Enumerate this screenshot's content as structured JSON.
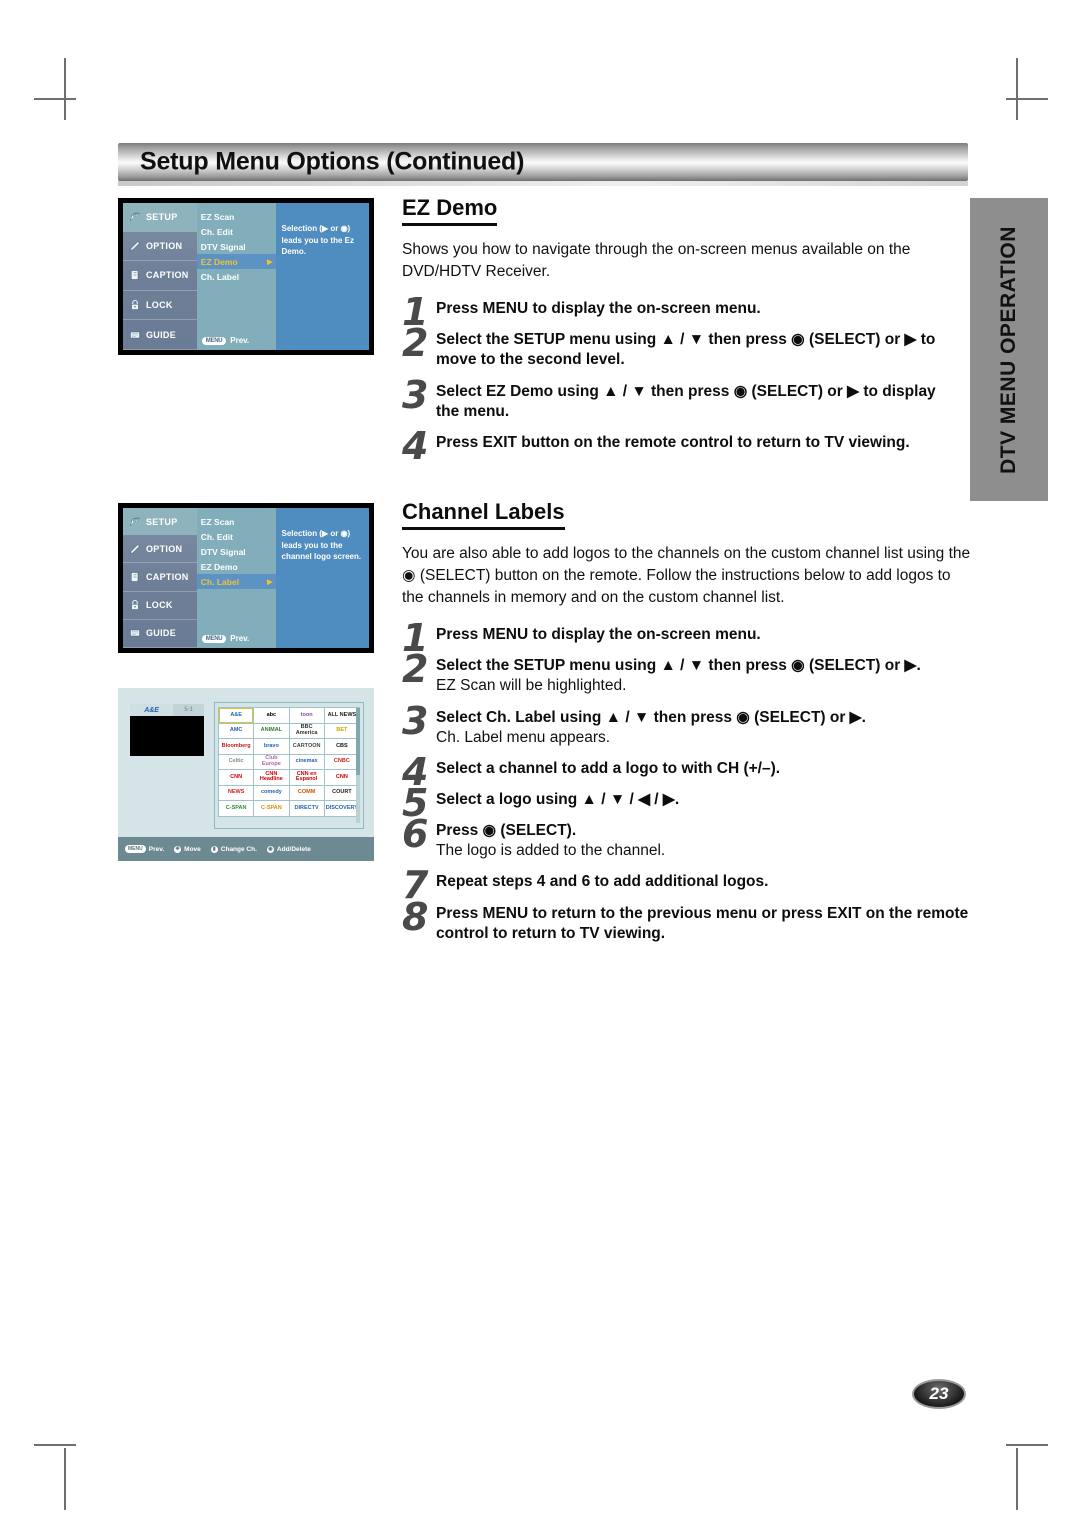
{
  "crop_marks": true,
  "header": {
    "title": "Setup Menu Options (Continued)"
  },
  "side_tab": {
    "label": "DTV MENU OPERATION"
  },
  "menu_screenshot_1": {
    "sidebar": [
      {
        "label": "SETUP",
        "icon": "satellite-dish-icon",
        "active": true
      },
      {
        "label": "OPTION",
        "icon": "pen-tag-icon",
        "active": false
      },
      {
        "label": "CAPTION",
        "icon": "caption-box-icon",
        "active": false
      },
      {
        "label": "LOCK",
        "icon": "padlock-icon",
        "active": false
      },
      {
        "label": "GUIDE",
        "icon": "guide-screen-icon",
        "active": false
      }
    ],
    "items": [
      {
        "label": "EZ Scan",
        "selected": false
      },
      {
        "label": "Ch. Edit",
        "selected": false
      },
      {
        "label": "DTV Signal",
        "selected": false
      },
      {
        "label": "EZ Demo",
        "selected": true
      },
      {
        "label": "Ch. Label",
        "selected": false
      }
    ],
    "prev_key": "MENU",
    "prev_label": "Prev.",
    "description": "Selection (▶ or ◉) leads you to the Ez Demo."
  },
  "menu_screenshot_2": {
    "sidebar": [
      {
        "label": "SETUP",
        "icon": "satellite-dish-icon",
        "active": true
      },
      {
        "label": "OPTION",
        "icon": "pen-tag-icon",
        "active": false
      },
      {
        "label": "CAPTION",
        "icon": "caption-box-icon",
        "active": false
      },
      {
        "label": "LOCK",
        "icon": "padlock-icon",
        "active": false
      },
      {
        "label": "GUIDE",
        "icon": "guide-screen-icon",
        "active": false
      }
    ],
    "items": [
      {
        "label": "EZ Scan",
        "selected": false
      },
      {
        "label": "Ch. Edit",
        "selected": false
      },
      {
        "label": "DTV Signal",
        "selected": false
      },
      {
        "label": "EZ Demo",
        "selected": false
      },
      {
        "label": "Ch. Label",
        "selected": true
      }
    ],
    "prev_key": "MENU",
    "prev_label": "Prev.",
    "description": "Selection (▶ or ◉) leads you to the channel logo screen."
  },
  "logo_screenshot": {
    "preview_logo": "A&E",
    "preview_channel": "5-1",
    "grid": [
      {
        "label": "A&E",
        "color": "#1f63b5",
        "selected": true
      },
      {
        "label": "abc",
        "color": "#000000",
        "selected": false
      },
      {
        "label": "toon",
        "color": "#7b4fa0",
        "selected": false
      },
      {
        "label": "ALL NEWS",
        "color": "#222222",
        "selected": false
      },
      {
        "label": "AMC",
        "color": "#1f63b5",
        "selected": false
      },
      {
        "label": "ANIMAL",
        "color": "#2e7d32",
        "selected": false
      },
      {
        "label": "BBC America",
        "color": "#333333",
        "selected": false
      },
      {
        "label": "BET",
        "color": "#c8a900",
        "selected": false
      },
      {
        "label": "Bloomberg",
        "color": "#c01a1a",
        "selected": false
      },
      {
        "label": "bravo",
        "color": "#1f63b5",
        "selected": false
      },
      {
        "label": "CARTOON",
        "color": "#444444",
        "selected": false
      },
      {
        "label": "CBS",
        "color": "#111111",
        "selected": false
      },
      {
        "label": "Celtic",
        "color": "#888888",
        "selected": false
      },
      {
        "label": "Club Europe",
        "color": "#aa66aa",
        "selected": false
      },
      {
        "label": "cinemax",
        "color": "#1f63b5",
        "selected": false
      },
      {
        "label": "CNBC",
        "color": "#cc2222",
        "selected": false
      },
      {
        "label": "CNN",
        "color": "#cc0000",
        "selected": false
      },
      {
        "label": "CNN Headline",
        "color": "#cc0000",
        "selected": false
      },
      {
        "label": "CNN en Espanol",
        "color": "#cc0000",
        "selected": false
      },
      {
        "label": "CNN",
        "color": "#cc0000",
        "selected": false
      },
      {
        "label": "NEWS",
        "color": "#cc2222",
        "selected": false
      },
      {
        "label": "comedy",
        "color": "#1f63b5",
        "selected": false
      },
      {
        "label": "COMM",
        "color": "#cc5500",
        "selected": false
      },
      {
        "label": "COURT",
        "color": "#222222",
        "selected": false
      },
      {
        "label": "C-SPAN",
        "color": "#2e8b3a",
        "selected": false
      },
      {
        "label": "C-SPAN",
        "color": "#d98f00",
        "selected": false
      },
      {
        "label": "DIRECTV",
        "color": "#1f63b5",
        "selected": false
      },
      {
        "label": "DISCOVERY",
        "color": "#1f63b5",
        "selected": false
      }
    ],
    "bottom_bar": [
      {
        "key": "MENU",
        "label": "Prev.",
        "icon": "menu-key-icon"
      },
      {
        "key": "✥",
        "label": "Move",
        "icon": "dpad-icon"
      },
      {
        "key": "▮",
        "label": "Change Ch.",
        "icon": "channel-key-icon"
      },
      {
        "key": "◉",
        "label": "Add/Delete",
        "icon": "select-key-icon"
      }
    ]
  },
  "section_ez_demo": {
    "title": "EZ Demo",
    "body": "Shows you how to navigate through the on-screen menus available on the DVD/HDTV Receiver.",
    "steps": [
      {
        "num": "1",
        "main": "Press MENU to display the on-screen menu.",
        "sub": ""
      },
      {
        "num": "2",
        "main": "Select the SETUP menu using ▲ / ▼ then press ◉ (SELECT) or ▶ to move to the second level.",
        "sub": ""
      },
      {
        "num": "3",
        "main": "Select EZ Demo using ▲ / ▼ then press ◉ (SELECT) or ▶ to display the menu.",
        "sub": ""
      },
      {
        "num": "4",
        "main": "Press EXIT button on the remote control to return to TV viewing.",
        "sub": ""
      }
    ]
  },
  "section_channel_labels": {
    "title": "Channel Labels",
    "body": "You are also able to add logos to the channels on the custom channel list using the ◉ (SELECT) button on the remote. Follow the instructions below to add logos to the channels in memory and on the custom channel list.",
    "steps": [
      {
        "num": "1",
        "main": "Press MENU to display the on-screen menu.",
        "sub": ""
      },
      {
        "num": "2",
        "main": "Select the SETUP menu using ▲ / ▼ then press ◉ (SELECT) or ▶.",
        "sub": "EZ Scan will be highlighted."
      },
      {
        "num": "3",
        "main": "Select Ch. Label using ▲ / ▼ then press ◉ (SELECT) or ▶.",
        "sub": "Ch. Label menu appears."
      },
      {
        "num": "4",
        "main": "Select a channel to add a logo to with CH (+/–).",
        "sub": ""
      },
      {
        "num": "5",
        "main": "Select a logo using ▲ / ▼ / ◀ / ▶.",
        "sub": ""
      },
      {
        "num": "6",
        "main": "Press ◉ (SELECT).",
        "sub": "The logo is added to the channel."
      },
      {
        "num": "7",
        "main": "Repeat steps 4 and 6 to add additional logos.",
        "sub": ""
      },
      {
        "num": "8",
        "main": "Press MENU to return to the previous menu or press EXIT on the remote control to return to TV viewing.",
        "sub": ""
      }
    ]
  },
  "page_number": "23"
}
